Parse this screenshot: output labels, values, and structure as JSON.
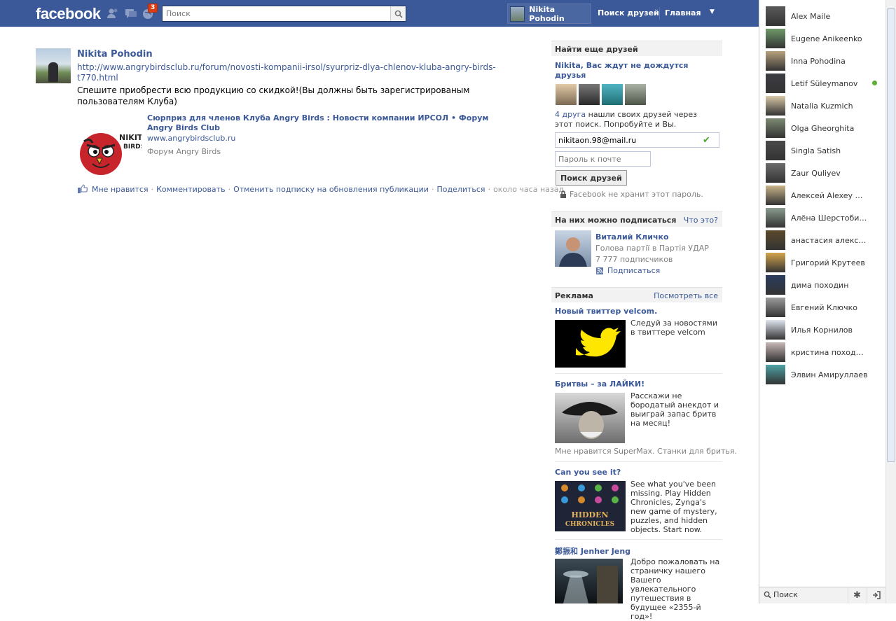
{
  "topbar": {
    "logo": "facebook",
    "notification_count": "3",
    "search_placeholder": "Поиск",
    "profile_name": "Nikita Pohodin",
    "nav": [
      "Поиск друзей",
      "Главная"
    ]
  },
  "story": {
    "author": "Nikita Pohodin",
    "link": "http://www.angrybirdsclub.ru/forum/novosti-kompanii-irsol/syurpriz-dlya-chlenov-kluba-angry-birds-t770.html",
    "text": "Спешите приобрести всю продукцию со скидкой!(Вы должны быть зарегистрированым пользователям Клуба)",
    "attachment": {
      "image_text": "NIKITA BIRDS",
      "title": "Сюрприз для членов Клуба Angry Birds : Новости компании ИРСОЛ • Форум Angry Birds Club",
      "domain": "www.angrybirdsclub.ru",
      "description": "Форум Angry Birds"
    },
    "actions": {
      "like": "Мне нравится",
      "comment": "Комментировать",
      "unfollow": "Отменить подписку на обновления публикации",
      "share": "Поделиться",
      "time": "около часа назад"
    }
  },
  "find_friends": {
    "header": "Найти еще друзей",
    "subtitle": "Nikita, Вас ждут не дождутся друзья",
    "friends_link": "4 друга",
    "text_rest": "нашли своих друзей через этот поиск. Попробуйте и Вы.",
    "email_value": "nikitaon.98@mail.ru",
    "password_placeholder": "Пароль к почте",
    "button": "Поиск друзей",
    "note": "Facebook не хранит этот пароль."
  },
  "subscribe": {
    "header": "На них можно подписаться",
    "header_link": "Что это?",
    "name": "Виталий Кличко",
    "role": "Голова партії в Партія УДАР",
    "subscribers": "7 777 подписчиков",
    "subscribe_label": "Подписаться"
  },
  "ads": {
    "header": "Реклама",
    "header_link": "Посмотреть все",
    "items": [
      {
        "title": "Новый твиттер velcom.",
        "text": "Следуй за новостями в твиттере velcom",
        "footer": ""
      },
      {
        "title": "Бритвы – за ЛАЙКИ!",
        "text": "Расскажи не бородатый анекдот и выиграй запас бритв на месяц!",
        "footer": "Мне нравится SuperMax. Станки для бритья."
      },
      {
        "title": "Can you see it?",
        "text": "See what you've been missing. Play Hidden Chronicles, Zynga's new game of mystery, puzzles, and hidden objects. Start now.",
        "image_text": "HIDDEN CHRONICLES",
        "footer": ""
      },
      {
        "title": "鄭振和 Jenher Jeng",
        "text": "Добро пожаловать на страничку нашего Вашего увлекательного путешествия в будущее «2355-й год»!",
        "footer": ""
      }
    ]
  },
  "chat": {
    "friends": [
      {
        "name": "Alex Maile",
        "online": false,
        "color": "#5a5a5a"
      },
      {
        "name": "Eugene Anikeenko",
        "online": false,
        "color": "#6f9a6a"
      },
      {
        "name": "Inna Pohodina",
        "online": false,
        "color": "#b8a27d"
      },
      {
        "name": "Letif Süleymanov",
        "online": true,
        "color": "#3c3c44"
      },
      {
        "name": "Natalia Kuzmich",
        "online": false,
        "color": "#d9c9a8"
      },
      {
        "name": "Olga Gheorghita",
        "online": false,
        "color": "#7d8a73"
      },
      {
        "name": "Singla Satish",
        "online": false,
        "color": "#4a4a4a"
      },
      {
        "name": "Zaur Quliyev",
        "online": false,
        "color": "#6c6c6c"
      },
      {
        "name": "Алексей Alexey Фе...",
        "online": false,
        "color": "#c9b48a"
      },
      {
        "name": "Алёна Шерстобитова",
        "online": false,
        "color": "#8a9c8e"
      },
      {
        "name": "анастасия александ...",
        "online": false,
        "color": "#5b4a2a"
      },
      {
        "name": "Григорий Крутеев",
        "online": false,
        "color": "#d4a54c"
      },
      {
        "name": "дима походин",
        "online": false,
        "color": "#2a3b5e"
      },
      {
        "name": "Евгений Ключко",
        "online": false,
        "color": "#9c9c9c"
      },
      {
        "name": "Илья Корнилов",
        "online": false,
        "color": "#dfe4ee"
      },
      {
        "name": "кристина походина",
        "online": false,
        "color": "#c7b7b5"
      },
      {
        "name": "Элвин Амируллаев",
        "online": false,
        "color": "#4fa3a7"
      }
    ],
    "search_label": "Поиск"
  }
}
